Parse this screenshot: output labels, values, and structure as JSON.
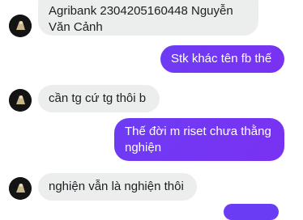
{
  "messages": [
    {
      "side": "incoming",
      "text": "Agribank 2304205160448 Nguyễn Văn Cảnh"
    },
    {
      "side": "outgoing",
      "text": "Stk khác tên fb thế"
    },
    {
      "side": "incoming",
      "text": "cần tg cứ tg thôi b"
    },
    {
      "side": "outgoing",
      "text": "Thế đời m riset chưa thằng nghiện"
    },
    {
      "side": "incoming",
      "text": "nghiện vẫn là nghiện thôi"
    }
  ],
  "colors": {
    "incoming_bubble": "#eceded",
    "outgoing_bubble": "#7034f3",
    "avatar_bg": "#141414"
  },
  "icons": {
    "avatar": "contact-avatar-icon"
  }
}
